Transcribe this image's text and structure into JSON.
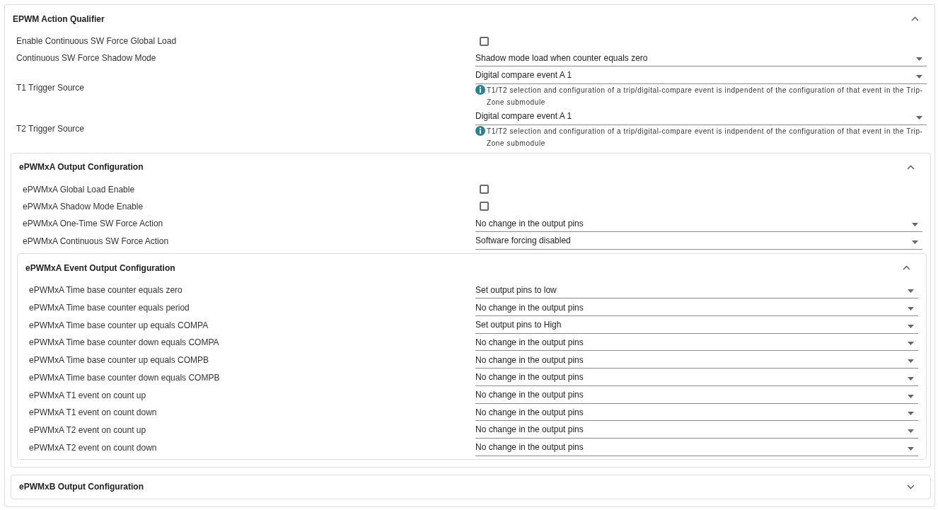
{
  "panel": {
    "title": "EPWM Action Qualifier",
    "expanded": true,
    "fields": [
      {
        "kind": "checkbox",
        "label": "Enable Continuous SW Force Global Load",
        "checked": false
      },
      {
        "kind": "select",
        "label": "Continuous SW Force Shadow Mode",
        "value": "Shadow mode load when counter equals zero"
      },
      {
        "kind": "select",
        "label": "T1 Trigger Source",
        "value": "Digital compare event A 1",
        "note": "T1/T2 selection and configuration of a trip/digital-compare event is indpendent of the configuration of that event in the Trip-Zone submodule"
      },
      {
        "kind": "select",
        "label": "T2 Trigger Source",
        "value": "Digital compare event A 1",
        "note": "T1/T2 selection and configuration of a trip/digital-compare event is indpendent of the configuration of that event in the Trip-Zone submodule"
      }
    ],
    "sections": [
      {
        "title": "ePWMxA Output Configuration",
        "expanded": true,
        "fields": [
          {
            "kind": "checkbox",
            "label": "ePWMxA Global Load Enable",
            "checked": false
          },
          {
            "kind": "checkbox",
            "label": "ePWMxA Shadow Mode Enable",
            "checked": false
          },
          {
            "kind": "select",
            "label": "ePWMxA One-Time SW Force Action",
            "value": "No change in the output pins"
          },
          {
            "kind": "select",
            "label": "ePWMxA Continuous SW Force Action",
            "value": "Software forcing disabled"
          }
        ],
        "sections": [
          {
            "title": "ePWMxA Event Output Configuration",
            "expanded": true,
            "fields": [
              {
                "kind": "select",
                "label": "ePWMxA Time base counter equals zero",
                "value": "Set output pins to low"
              },
              {
                "kind": "select",
                "label": "ePWMxA Time base counter equals period",
                "value": "No change in the output pins"
              },
              {
                "kind": "select",
                "label": "ePWMxA Time base counter up equals COMPA",
                "value": "Set output pins to High"
              },
              {
                "kind": "select",
                "label": "ePWMxA Time base counter down equals COMPA",
                "value": "No change in the output pins"
              },
              {
                "kind": "select",
                "label": "ePWMxA Time base counter up equals COMPB",
                "value": "No change in the output pins"
              },
              {
                "kind": "select",
                "label": "ePWMxA Time base counter down equals COMPB",
                "value": "No change in the output pins"
              },
              {
                "kind": "select",
                "label": "ePWMxA T1 event on count up",
                "value": "No change in the output pins"
              },
              {
                "kind": "select",
                "label": "ePWMxA T1 event on count down",
                "value": "No change in the output pins"
              },
              {
                "kind": "select",
                "label": "ePWMxA T2 event on count up",
                "value": "No change in the output pins"
              },
              {
                "kind": "select",
                "label": "ePWMxA T2 event on count down",
                "value": "No change in the output pins"
              }
            ]
          }
        ]
      },
      {
        "title": "ePWMxB Output Configuration",
        "expanded": false
      }
    ]
  }
}
